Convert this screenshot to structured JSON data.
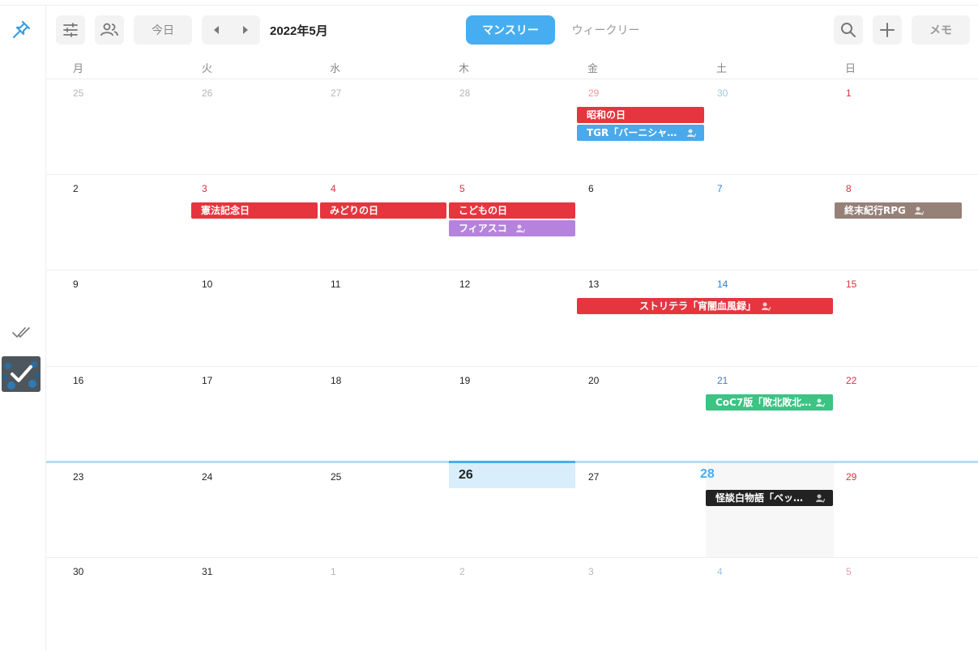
{
  "toolbar": {
    "today_label": "今日",
    "month_label": "2022年5月",
    "view_monthly_label": "マンスリー",
    "view_weekly_label": "ウィークリー",
    "memo_label": "メモ",
    "icons": [
      "pin-icon",
      "filter-sliders-icon",
      "group-icon",
      "prev-arrow-icon",
      "next-arrow-icon",
      "search-icon",
      "plus-icon",
      "double-check-icon",
      "check-icon"
    ]
  },
  "weekdays": [
    "月",
    "火",
    "水",
    "木",
    "金",
    "土",
    "日"
  ],
  "weeks": [
    [
      "25",
      "26",
      "27",
      "28",
      "29",
      "30",
      "1"
    ],
    [
      "2",
      "3",
      "4",
      "5",
      "6",
      "7",
      "8"
    ],
    [
      "9",
      "10",
      "11",
      "12",
      "13",
      "14",
      "15"
    ],
    [
      "16",
      "17",
      "18",
      "19",
      "20",
      "21",
      "22"
    ],
    [
      "23",
      "24",
      "25",
      "26",
      "27",
      "28",
      "29"
    ],
    [
      "30",
      "31",
      "1",
      "2",
      "3",
      "4",
      "5"
    ]
  ],
  "events": {
    "showa": "昭和の日",
    "tgr": "TGR「バーニシャ…",
    "kenpo": "憲法記念日",
    "midori": "みどりの日",
    "kodomo": "こどもの日",
    "fiasco": "フィアスコ",
    "shumatsu": "終末紀行RPG",
    "storytella": "ストリテラ「宵闇血風録」",
    "coc": "CoC7版「敗北敗北…",
    "kaidan": "怪談白物語「ベッ…"
  },
  "colors": {
    "accent": "#46aef0",
    "holiday_red": "#e5363f",
    "tgr_blue": "#4aa9ea",
    "fiasco_purple": "#b583dd",
    "shumatsu_brown": "#958178",
    "coc_green": "#3bc483",
    "kaidan_black": "#222222",
    "saturday_blue": "#2f7fd6",
    "sunday_red": "#d6333b"
  }
}
